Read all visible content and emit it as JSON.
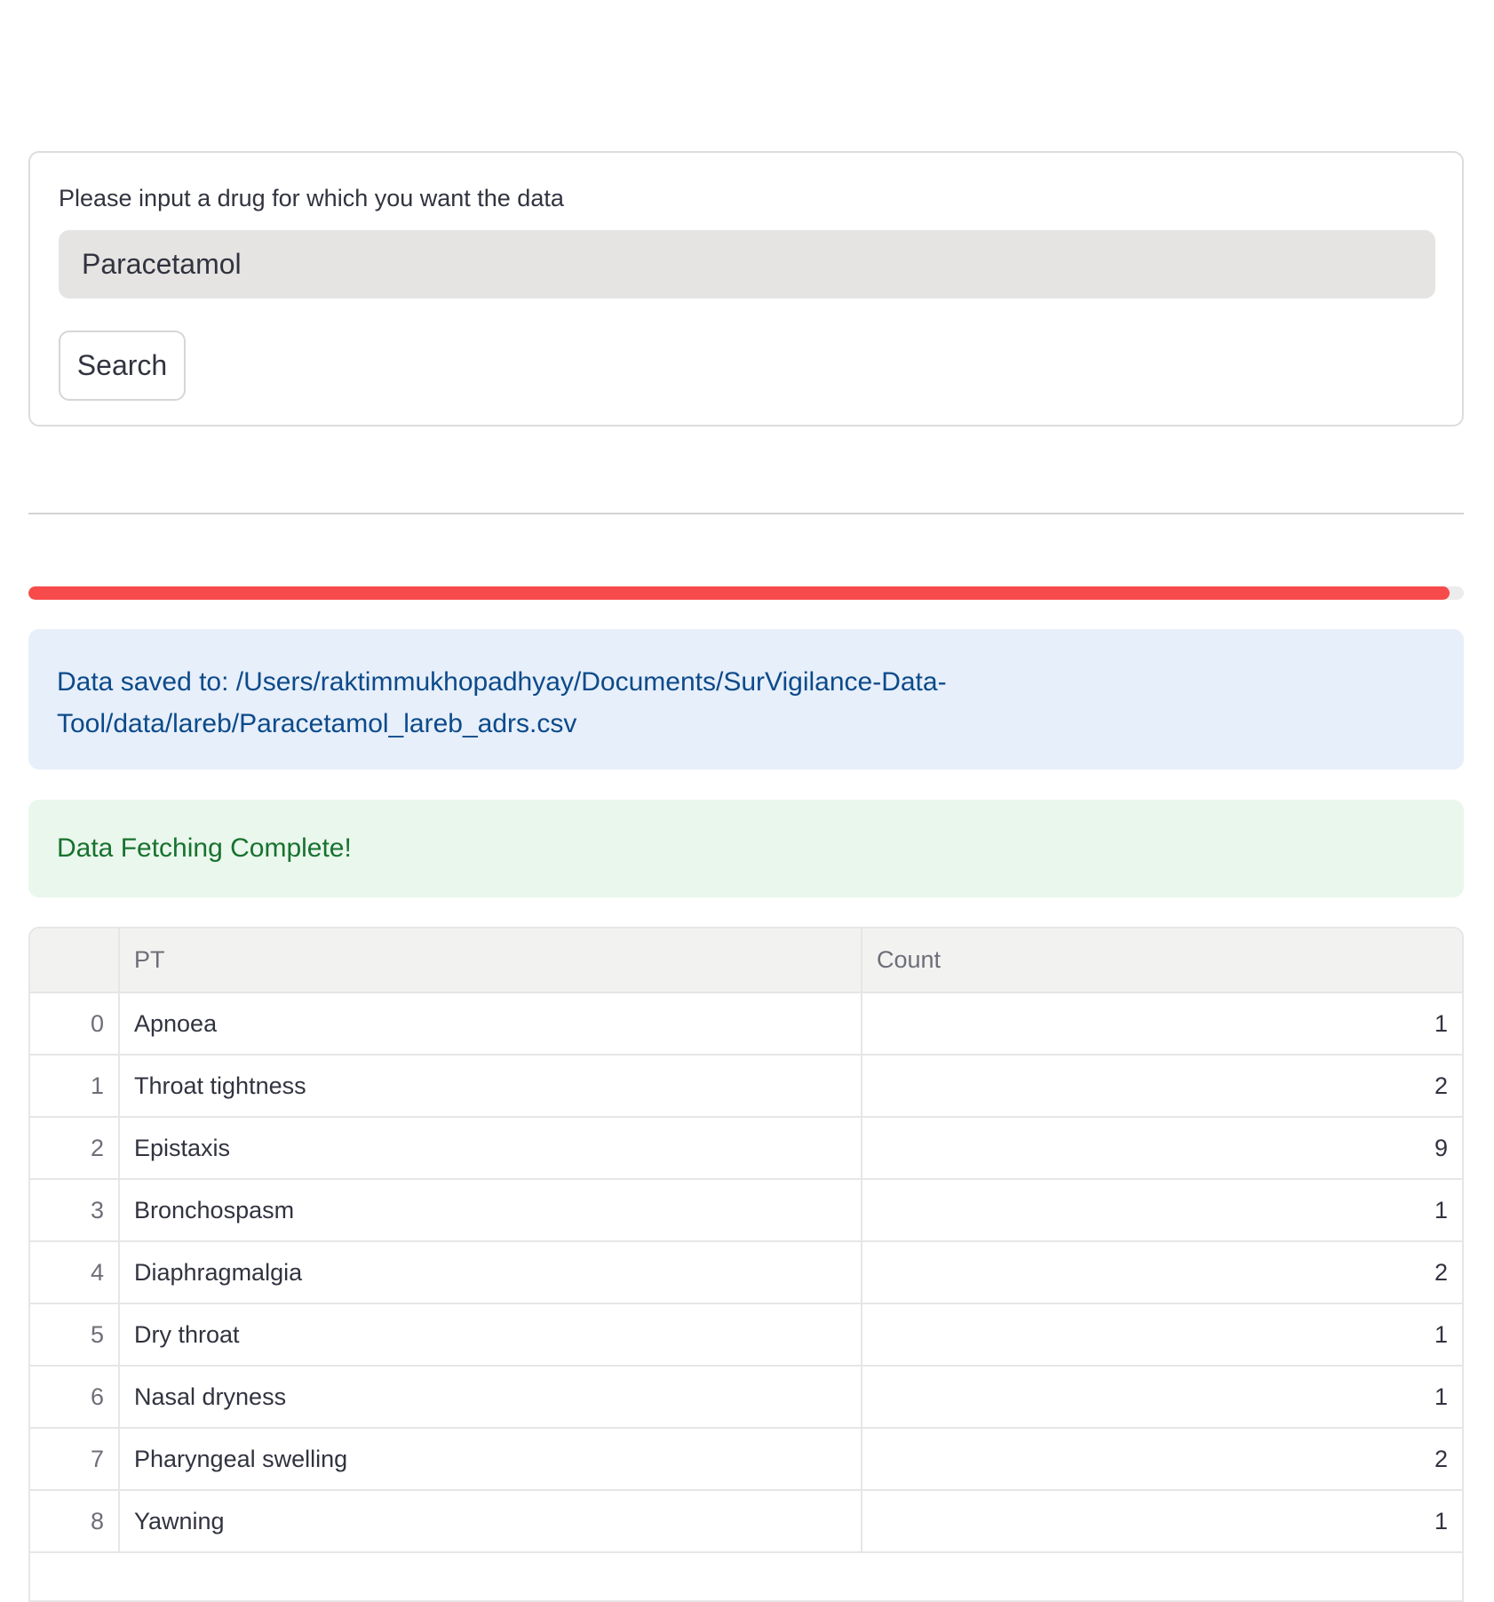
{
  "form": {
    "label": "Please input a drug for which you want the data",
    "input_value": "Paracetamol",
    "search_label": "Search"
  },
  "progress": {
    "fraction": 0.99
  },
  "info": {
    "line1": "Data saved to: /Users/raktimmukhopadhyay/Documents/SurVigilance-Data-",
    "line2": "Tool/data/lareb/Paracetamol_lareb_adrs.csv"
  },
  "success": {
    "message": "Data Fetching Complete!"
  },
  "colors": {
    "progress": "#f74b4b",
    "info_bg": "#e7effa",
    "info_text": "#0c4a8a",
    "success_bg": "#eaf7ed",
    "success_text": "#17722e"
  },
  "table": {
    "headers": [
      "",
      "PT",
      "Count"
    ],
    "rows": [
      {
        "index": "0",
        "pt": "Apnoea",
        "count": "1"
      },
      {
        "index": "1",
        "pt": "Throat tightness",
        "count": "2"
      },
      {
        "index": "2",
        "pt": "Epistaxis",
        "count": "9"
      },
      {
        "index": "3",
        "pt": "Bronchospasm",
        "count": "1"
      },
      {
        "index": "4",
        "pt": "Diaphragmalgia",
        "count": "2"
      },
      {
        "index": "5",
        "pt": "Dry throat",
        "count": "1"
      },
      {
        "index": "6",
        "pt": "Nasal dryness",
        "count": "1"
      },
      {
        "index": "7",
        "pt": "Pharyngeal swelling",
        "count": "2"
      },
      {
        "index": "8",
        "pt": "Yawning",
        "count": "1"
      }
    ]
  }
}
